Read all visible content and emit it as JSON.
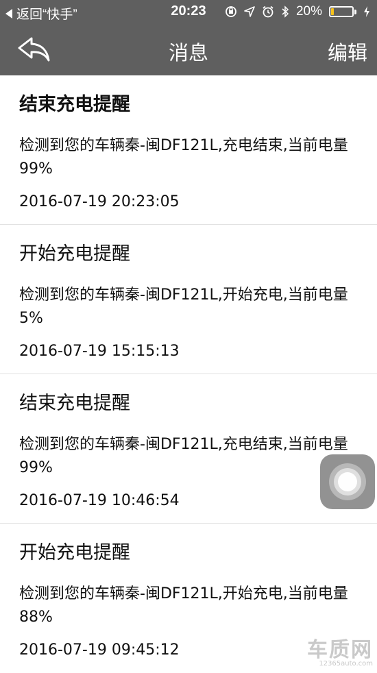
{
  "status_bar": {
    "back_app": "返回“快手”",
    "time": "20:23",
    "battery_percent": "20%",
    "battery_level": 0.2,
    "icons": [
      "orientation-lock-icon",
      "location-icon",
      "alarm-icon",
      "bluetooth-icon",
      "battery-icon",
      "charging-icon"
    ]
  },
  "nav": {
    "title": "消息",
    "edit_label": "编辑",
    "back_icon": "back-arrow-icon"
  },
  "messages": [
    {
      "title": "结束充电提醒",
      "body": "检测到您的车辆秦-闽DF121L,充电结束,当前电量99%",
      "time": "2016-07-19 20:23:05"
    },
    {
      "title": "开始充电提醒",
      "body": "检测到您的车辆秦-闽DF121L,开始充电,当前电量5%",
      "time": "2016-07-19 15:15:13"
    },
    {
      "title": "结束充电提醒",
      "body": "检测到您的车辆秦-闽DF121L,充电结束,当前电量99%",
      "time": "2016-07-19 10:46:54"
    },
    {
      "title": "开始充电提醒",
      "body": "检测到您的车辆秦-闽DF121L,开始充电,当前电量88%",
      "time": "2016-07-19 09:45:12"
    }
  ],
  "watermark": {
    "main": "车质网",
    "sub": "12365auto.com"
  },
  "colors": {
    "bar_bg": "#5f5f5f",
    "battery": "#f7c21a",
    "divider": "#e2e2e2"
  }
}
